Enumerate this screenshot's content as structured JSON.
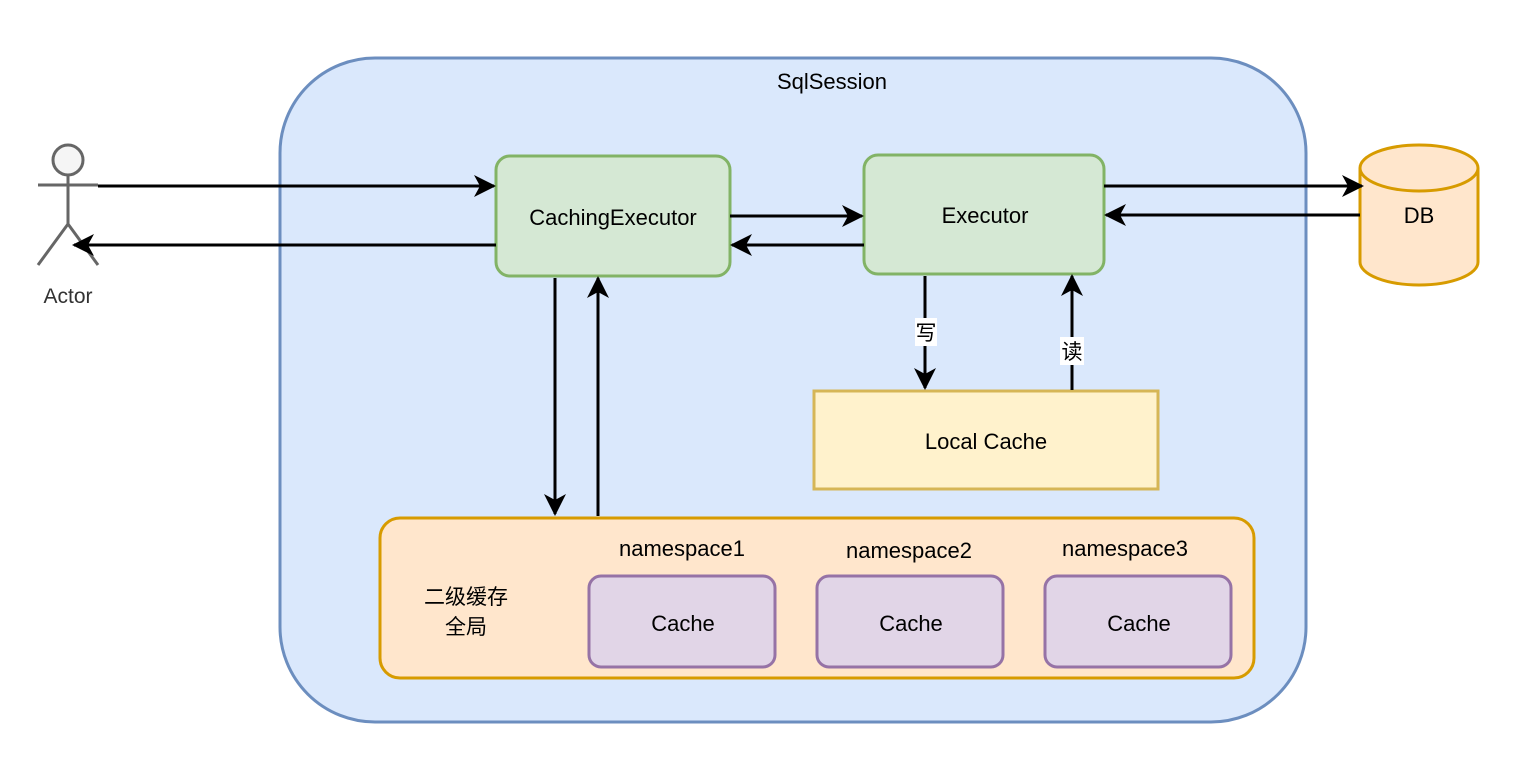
{
  "diagram": {
    "session_label": "SqlSession",
    "actor_label": "Actor",
    "caching_executor_label": "CachingExecutor",
    "executor_label": "Executor",
    "db_label": "DB",
    "local_cache_label": "Local Cache",
    "write_label": "写",
    "read_label": "读",
    "second_level": {
      "label_line1": "二级缓存",
      "label_line2": "全局",
      "namespaces": [
        {
          "name": "namespace1",
          "cache_label": "Cache"
        },
        {
          "name": "namespace2",
          "cache_label": "Cache"
        },
        {
          "name": "namespace3",
          "cache_label": "Cache"
        }
      ]
    }
  },
  "colors": {
    "session_fill": "#dae8fc",
    "session_stroke": "#6c8ebf",
    "executor_fill": "#d5e8d4",
    "executor_stroke": "#82b366",
    "db_fill": "#ffe6cc",
    "db_stroke": "#d79b00",
    "local_cache_fill": "#fff2cc",
    "local_cache_stroke": "#d6b656",
    "second_level_fill": "#ffe6cc",
    "second_level_stroke": "#d79b00",
    "cache_fill": "#e1d5e7",
    "cache_stroke": "#9673a6",
    "actor_stroke": "#666666",
    "actor_fill": "#f5f5f5",
    "arrow": "#000000"
  }
}
